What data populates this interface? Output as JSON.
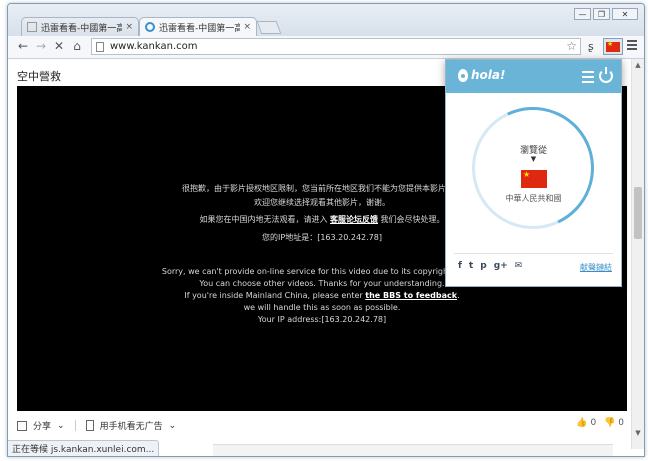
{
  "tabs": [
    {
      "title": "迅雷看看-中國第一高清影",
      "close": "×",
      "active": false
    },
    {
      "title": "迅雷看看-中國第一高清影",
      "close": "×",
      "active": true
    }
  ],
  "window_buttons": {
    "minimize": "—",
    "restore": "❐",
    "close": "✕"
  },
  "toolbar": {
    "back": "←",
    "forward": "→",
    "stop": "✕",
    "home": "⌂",
    "url": "www.kankan.com",
    "bookmark_star": "☆",
    "extension_glyph": "ʂ"
  },
  "page": {
    "video_title": "空中營救",
    "notice_cn": {
      "line1": "很抱歉，由于影片授权地区限制，您当前所在地区我们不能为您提供本影片在线",
      "line2": "欢迎您继续选择观看其他影片，谢谢。",
      "line3_pre": "如果您在中国内地无法观看，请进入",
      "line3_link": "客服论坛反馈",
      "line3_post": "我们会尽快处理。",
      "line4": "您的IP地址是：[163.20.242.78]"
    },
    "notice_en": {
      "line1": "Sorry, we can't provide on-line service for this video due to its copyright restrict",
      "line2": "You can choose other videos. Thanks for your understanding.",
      "line3_pre": "If you're inside Mainland China, please enter",
      "line3_link": "the BBS to feedback",
      "line3_post": ".",
      "line4": "we will handle this as soon as possible.",
      "line5": "Your IP address:[163.20.242.78]"
    },
    "share_label": "分享",
    "mobile_label": "用手机看无广告",
    "like_count": "0",
    "dislike_count": "0"
  },
  "status_text": "正在等候 js.kankan.xunlei.com...",
  "hola": {
    "logo_text": "hola!",
    "browse_from": "瀏覽從",
    "arrow": "▼",
    "country": "中華人民共和國",
    "social_icons": [
      "f",
      "t",
      "p",
      "g+",
      "✉"
    ],
    "feedback_link": "献聲鏈結",
    "colors": {
      "header": "#6ab4d8",
      "ring": "#5fb0d8",
      "flag_red": "#de2910",
      "flag_star": "#ffde00"
    }
  }
}
